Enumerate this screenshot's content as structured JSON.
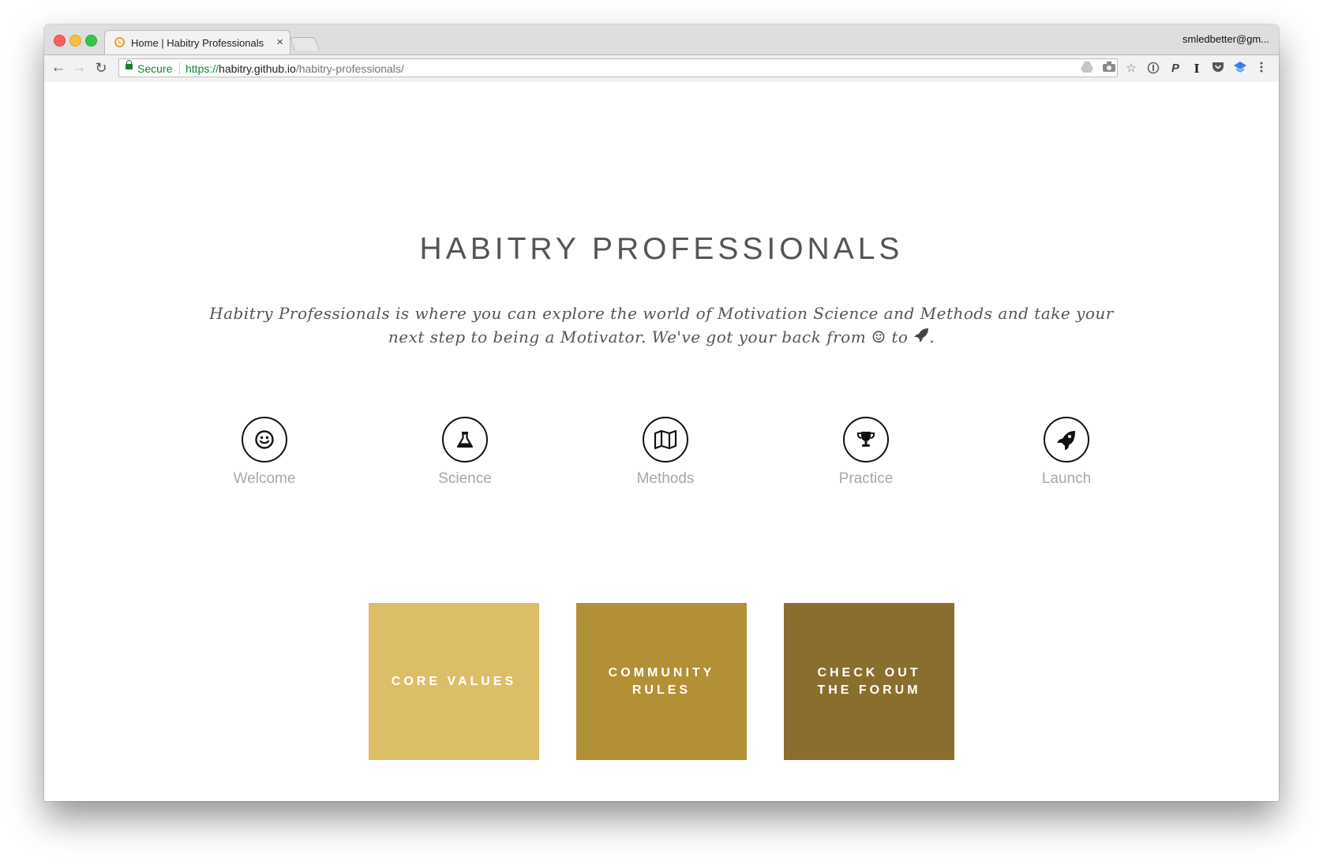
{
  "browser": {
    "tab": {
      "title": "Home | Habitry Professionals",
      "close_glyph": "×"
    },
    "profile": "smledbetter@gm...",
    "nav": {
      "back": "←",
      "forward": "→",
      "reload": "↻"
    },
    "address": {
      "secure_label": "Secure",
      "scheme": "https://",
      "host": "habitry.github.io",
      "path": "/habitry-professionals/"
    },
    "toolbar_icons": [
      "drive-icon",
      "camera-icon",
      "star-icon",
      "password-icon",
      "paypal-icon",
      "instapaper-icon",
      "pocket-icon",
      "extension-icon",
      "menu-icon"
    ]
  },
  "page": {
    "title": "HABITRY PROFESSIONALS",
    "intro_text": "Habitry Professionals is where you can explore the world of Motivation Science and Methods and take your next step to being a Motivator. We've got your back from",
    "intro_to": "to",
    "intro_end": "."
  },
  "stages": [
    {
      "label": "Welcome",
      "icon": "smile-icon"
    },
    {
      "label": "Science",
      "icon": "flask-icon"
    },
    {
      "label": "Methods",
      "icon": "map-icon"
    },
    {
      "label": "Practice",
      "icon": "trophy-icon"
    },
    {
      "label": "Launch",
      "icon": "rocket-icon"
    }
  ],
  "cta": [
    {
      "line1": "CORE VALUES",
      "line2": "",
      "color": "#dcbe69"
    },
    {
      "line1": "COMMUNITY",
      "line2": "RULES",
      "color": "#b38f35"
    },
    {
      "line1": "CHECK OUT",
      "line2": "THE FORUM",
      "color": "#8a6e2d"
    }
  ]
}
